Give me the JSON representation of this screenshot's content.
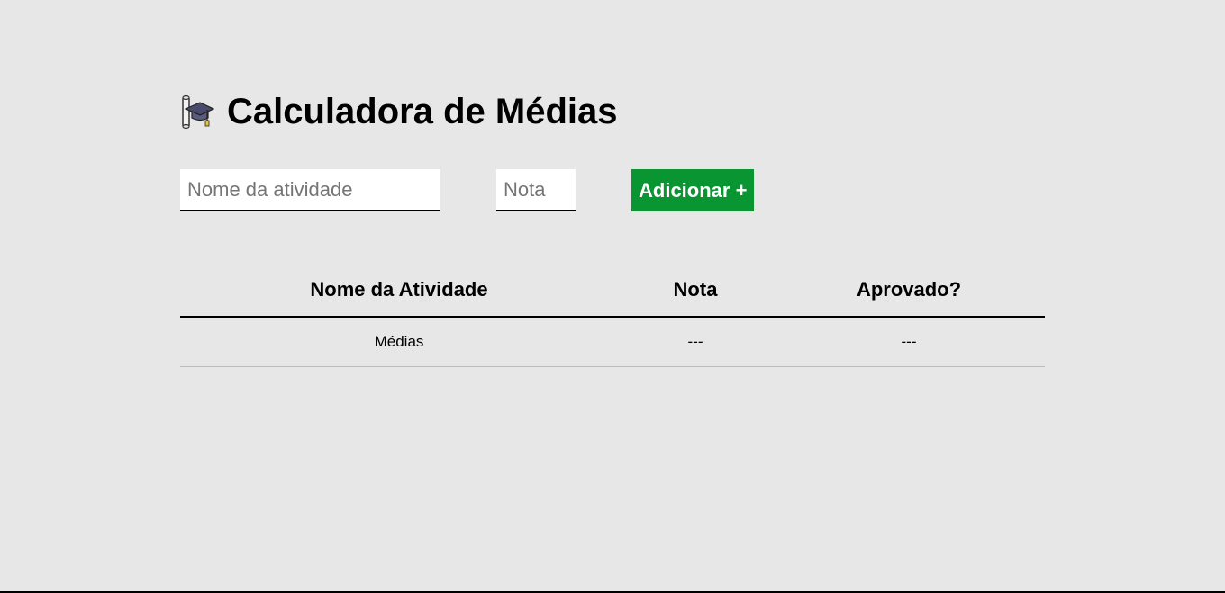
{
  "header": {
    "icon": "graduation-cap-icon",
    "title": "Calculadora de Médias"
  },
  "form": {
    "activity_placeholder": "Nome da atividade",
    "activity_value": "",
    "grade_placeholder": "Nota",
    "grade_value": "",
    "add_button_label": "Adicionar +"
  },
  "table": {
    "columns": [
      "Nome da Atividade",
      "Nota",
      "Aprovado?"
    ],
    "rows": [
      [
        "Médias",
        "---",
        "---"
      ]
    ]
  },
  "colors": {
    "background": "#e7e7e7",
    "button": "#0a9533",
    "button_text": "#ffffff"
  }
}
